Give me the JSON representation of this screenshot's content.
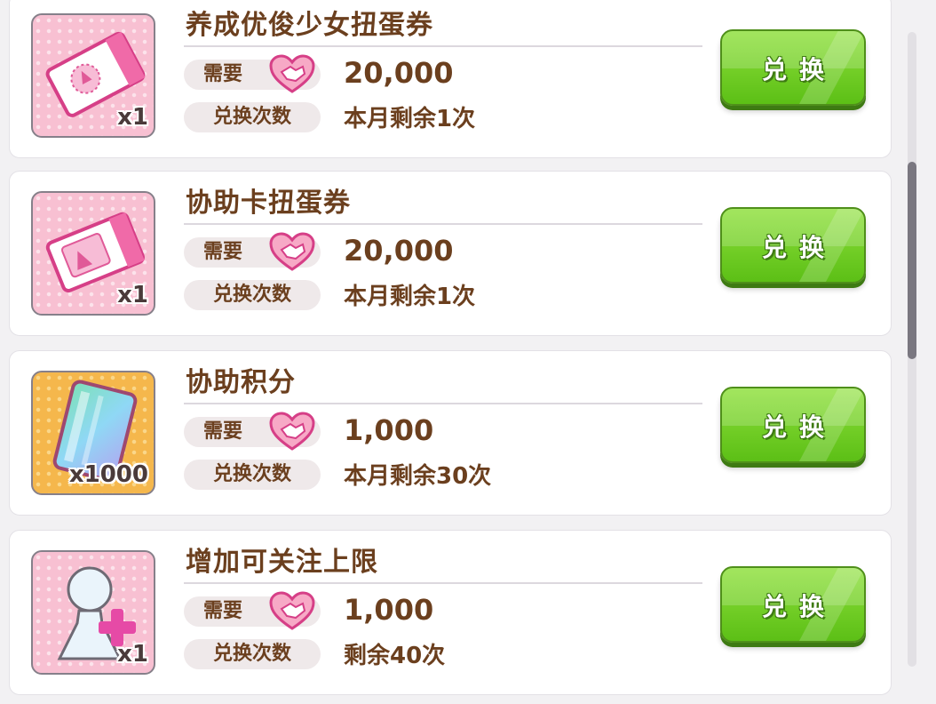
{
  "require_label": "需要",
  "count_label": "兑换次数",
  "items": [
    {
      "title": "养成优俊少女扭蛋券",
      "qty": "x1",
      "cost": "20,000",
      "remaining": "本月剩余1次",
      "button": "兑换",
      "icon": "training-gacha-ticket-icon"
    },
    {
      "title": "协助卡扭蛋券",
      "qty": "x1",
      "cost": "20,000",
      "remaining": "本月剩余1次",
      "button": "兑换",
      "icon": "support-gacha-ticket-icon"
    },
    {
      "title": "协助积分",
      "qty": "x1000",
      "cost": "1,000",
      "remaining": "本月剩余30次",
      "button": "兑换",
      "icon": "support-point-card-icon"
    },
    {
      "title": "增加可关注上限",
      "qty": "x1",
      "cost": "1,000",
      "remaining": "剩余40次",
      "button": "兑换",
      "icon": "follow-limit-plus-icon"
    }
  ],
  "colors": {
    "accent_green": "#6cc81e",
    "title_brown": "#6b3f1e",
    "heart_pink": "#e8508a"
  }
}
